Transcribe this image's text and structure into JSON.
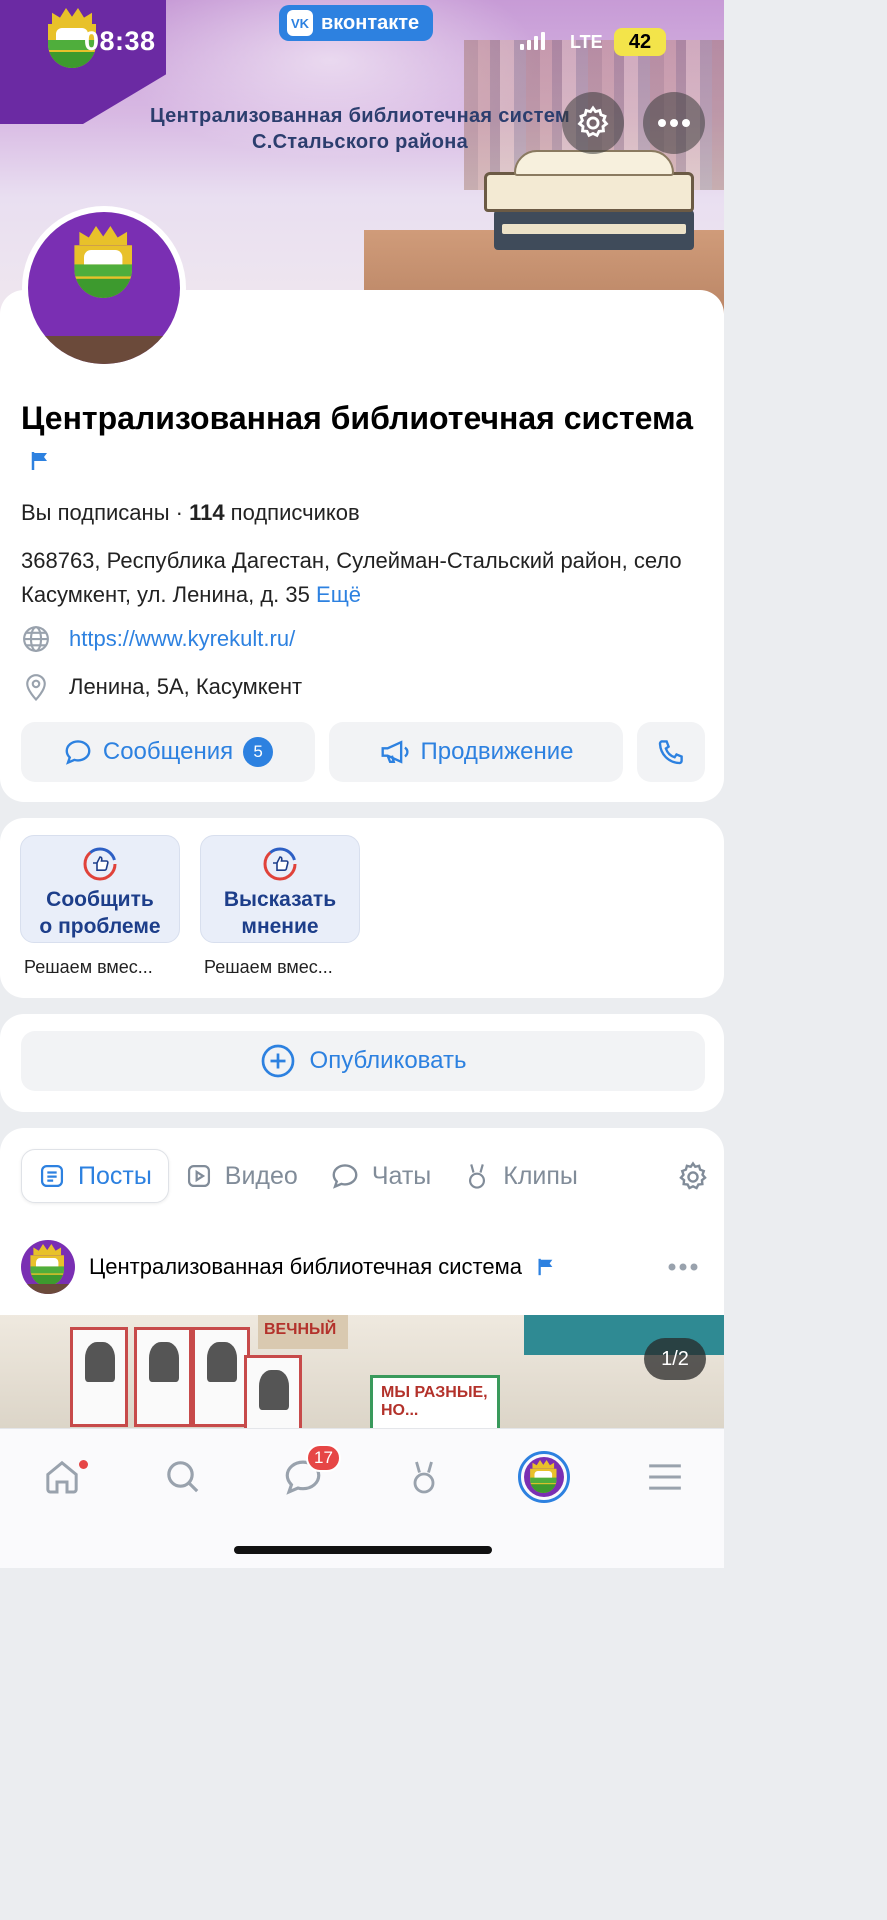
{
  "status_bar": {
    "time": "08:38",
    "network": "LTE",
    "battery": "42"
  },
  "app_badge": {
    "logo": "VK",
    "label": "вконтакте"
  },
  "cover": {
    "title_line1": "Централизованная библиотечная систем",
    "title_line2": "С.Стальского района"
  },
  "group": {
    "name": "Централизованная библиотечная система",
    "subscribed_text": "Вы подписаны · ",
    "subscribers_count": "114",
    "subscribers_label": " подписчиков",
    "address": "368763, Республика Дагестан, Сулейман-Стальский район, село Касумкент, ул. Ленина, д. 35",
    "more_label": "Ещё",
    "website": "https://www.kyrekult.ru/",
    "location": "Ленина, 5А, Касумкент"
  },
  "actions": {
    "messages_label": "Сообщения",
    "messages_count": "5",
    "promo_label": "Продвижение"
  },
  "services": [
    {
      "title_line1": "Сообщить",
      "title_line2": "о проблеме",
      "caption": "Решаем вмес..."
    },
    {
      "title_line1": "Высказать",
      "title_line2": "мнение",
      "caption": "Решаем вмес..."
    }
  ],
  "publish_label": "Опубликовать",
  "tabs": [
    {
      "label": "Посты",
      "icon": "posts-icon",
      "active": true
    },
    {
      "label": "Видео",
      "icon": "video-icon"
    },
    {
      "label": "Чаты",
      "icon": "chat-icon"
    },
    {
      "label": "Клипы",
      "icon": "clips-icon"
    }
  ],
  "post": {
    "author": "Централизованная библиотечная система",
    "photo_counter": "1/2",
    "photo_banner": "ВЕЧНЫЙ",
    "photo_poster": "МЫ РАЗНЫЕ, НО..."
  },
  "bottom_nav": {
    "messages_badge": "17",
    "items": [
      "home-icon",
      "search-icon",
      "messenger-icon",
      "clips-icon",
      "profile-avatar",
      "menu-icon"
    ]
  },
  "colors": {
    "accent": "#2d81e0",
    "badge_red": "#e64646",
    "brand_purple": "#6b2aa3"
  }
}
